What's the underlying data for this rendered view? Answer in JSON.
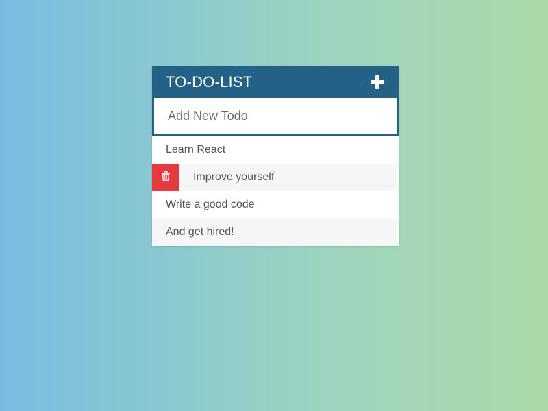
{
  "header": {
    "title": "TO-DO-LIST",
    "add_icon": "plus-icon"
  },
  "input": {
    "placeholder": "Add New Todo",
    "value": ""
  },
  "todos": [
    {
      "label": "Learn React",
      "hovered": false
    },
    {
      "label": "Improve yourself",
      "hovered": true
    },
    {
      "label": "Write a good code",
      "hovered": false
    },
    {
      "label": "And get hired!",
      "hovered": false
    }
  ],
  "delete_icon": "trash-icon",
  "colors": {
    "header_bg": "#246186",
    "delete_bg": "#e8393f",
    "gradient_left": "#77bde0",
    "gradient_right": "#aadaa8"
  }
}
